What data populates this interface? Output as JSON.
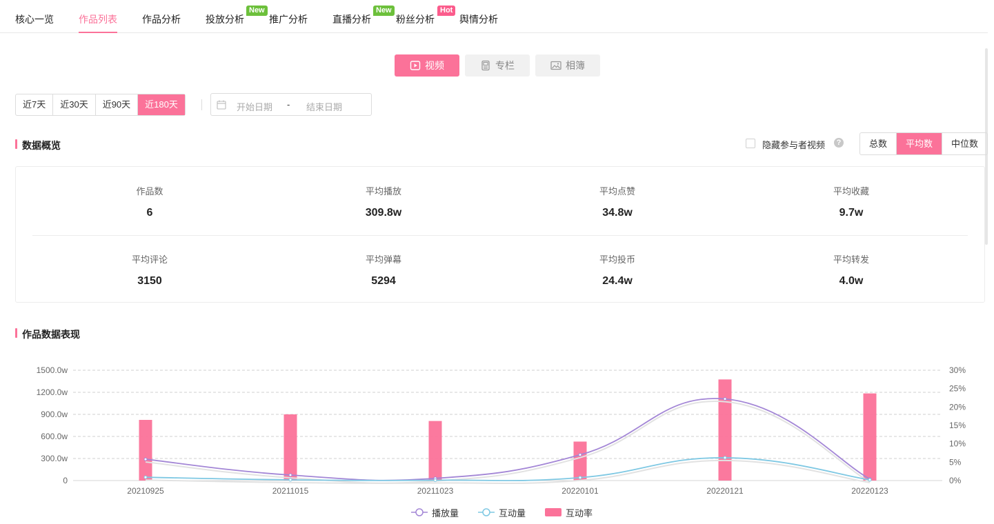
{
  "nav": {
    "tabs": [
      {
        "label": "核心一览"
      },
      {
        "label": "作品列表",
        "active": true
      },
      {
        "label": "作品分析"
      },
      {
        "label": "投放分析",
        "badge": "New"
      },
      {
        "label": "推广分析"
      },
      {
        "label": "直播分析",
        "badge": "New"
      },
      {
        "label": "粉丝分析",
        "badge": "Hot"
      },
      {
        "label": "舆情分析"
      }
    ]
  },
  "content_types": {
    "video": "视频",
    "column": "专栏",
    "album": "相簿",
    "active": "video"
  },
  "day_range": {
    "options": [
      "近7天",
      "近30天",
      "近90天",
      "近180天"
    ],
    "active": "近180天"
  },
  "date_range": {
    "start_placeholder": "开始日期",
    "separator": "-",
    "end_placeholder": "结束日期"
  },
  "overview": {
    "title": "数据概览",
    "hide_label": "隐藏参与者视频",
    "help": "?",
    "aggregate": [
      "总数",
      "平均数",
      "中位数"
    ],
    "aggregate_active": "平均数",
    "stats": [
      {
        "label": "作品数",
        "value": "6"
      },
      {
        "label": "平均播放",
        "value": "309.8w"
      },
      {
        "label": "平均点赞",
        "value": "34.8w"
      },
      {
        "label": "平均收藏",
        "value": "9.7w"
      },
      {
        "label": "平均评论",
        "value": "3150"
      },
      {
        "label": "平均弹幕",
        "value": "5294"
      },
      {
        "label": "平均投币",
        "value": "24.4w"
      },
      {
        "label": "平均转发",
        "value": "4.0w"
      }
    ]
  },
  "performance": {
    "title": "作品数据表现"
  },
  "colors": {
    "accent": "#fb7299",
    "play_line": "#a386d6",
    "interact_line": "#7ec8e3",
    "rate_bar": "#fb7299"
  },
  "chart_data": {
    "type": "bar",
    "categories": [
      "20210925",
      "20211015",
      "20211023",
      "20220101",
      "20220121",
      "20220123"
    ],
    "y_left_ticks": [
      "0",
      "300.0w",
      "600.0w",
      "900.0w",
      "1200.0w",
      "1500.0w"
    ],
    "y_left_range": [
      0,
      1500
    ],
    "y_right_ticks": [
      "0%",
      "5%",
      "10%",
      "15%",
      "20%",
      "25%",
      "30%"
    ],
    "y_right_range": [
      0,
      30
    ],
    "grid": true,
    "legend_position": "bottom",
    "series": [
      {
        "name": "播放量",
        "type": "line",
        "axis": "left",
        "values": [
          290,
          75,
          30,
          350,
          1110,
          20
        ]
      },
      {
        "name": "互动量",
        "type": "line",
        "axis": "left",
        "values": [
          45,
          10,
          5,
          40,
          310,
          10
        ]
      },
      {
        "name": "互动率",
        "type": "bar",
        "axis": "right",
        "values": [
          16.5,
          18,
          16.2,
          10.6,
          27.5,
          23.7
        ]
      }
    ]
  }
}
